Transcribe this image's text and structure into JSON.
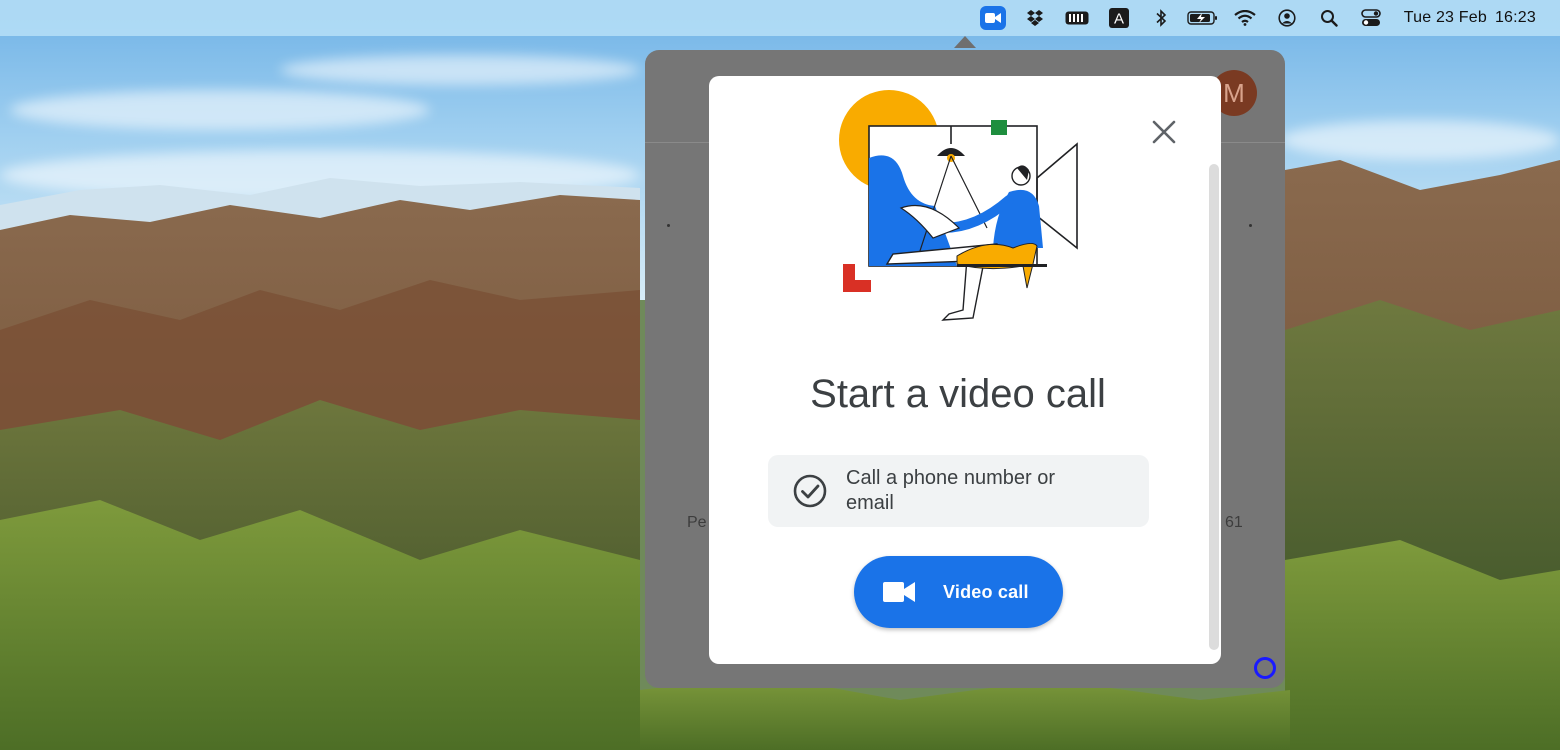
{
  "menubar": {
    "icons": [
      "video-camera-icon",
      "dropbox-icon",
      "battery-meter-icon",
      "input-source-a-icon",
      "bluetooth-icon",
      "battery-charging-icon",
      "wifi-icon",
      "user-account-icon",
      "spotlight-search-icon",
      "control-center-icon"
    ],
    "input_source_letter": "A",
    "date": "Tue 23 Feb",
    "time": "16:23",
    "active_color": "#1a73e8"
  },
  "app": {
    "avatar_initial": "M",
    "left_hidden_text": "Pe",
    "right_hidden_text": "61"
  },
  "dialog": {
    "title": "Start a video call",
    "call_option_label": "Call a phone number or email",
    "video_call_label": "Video call",
    "close_icon": "close-icon",
    "accent_color": "#1a73e8"
  }
}
